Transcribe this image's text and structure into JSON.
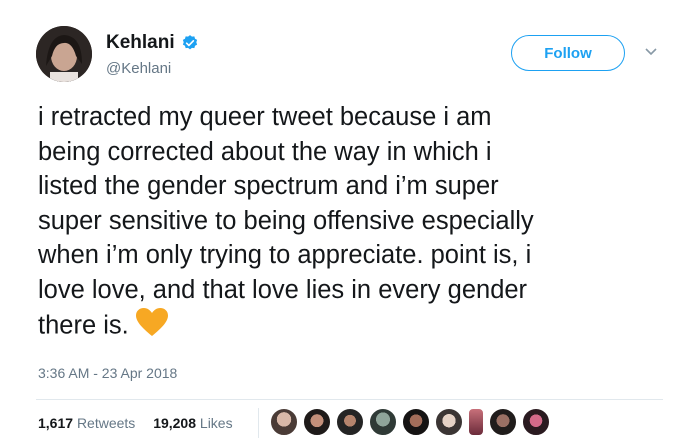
{
  "author": {
    "name": "Kehlani",
    "handle": "@Kehlani",
    "verified_icon": "verified-badge-icon"
  },
  "follow_label": "Follow",
  "tweet_lines": [
    "i retracted my queer tweet because i am",
    "being corrected about the way in which i",
    "listed the gender spectrum and i’m super",
    "super sensitive to being offensive especially",
    "when i’m only trying to appreciate. point is, i",
    "love love, and that love lies in every gender",
    "there is."
  ],
  "emoji_icon": "orange-heart-icon",
  "timestamp": "3:36 AM - 23 Apr 2018",
  "stats": {
    "retweets_count": "1,617",
    "retweets_label": "Retweets",
    "likes_count": "19,208",
    "likes_label": "Likes"
  },
  "colors": {
    "accent": "#1da1f2",
    "text": "#14171a",
    "muted": "#657786",
    "heart": "#f7a823"
  }
}
